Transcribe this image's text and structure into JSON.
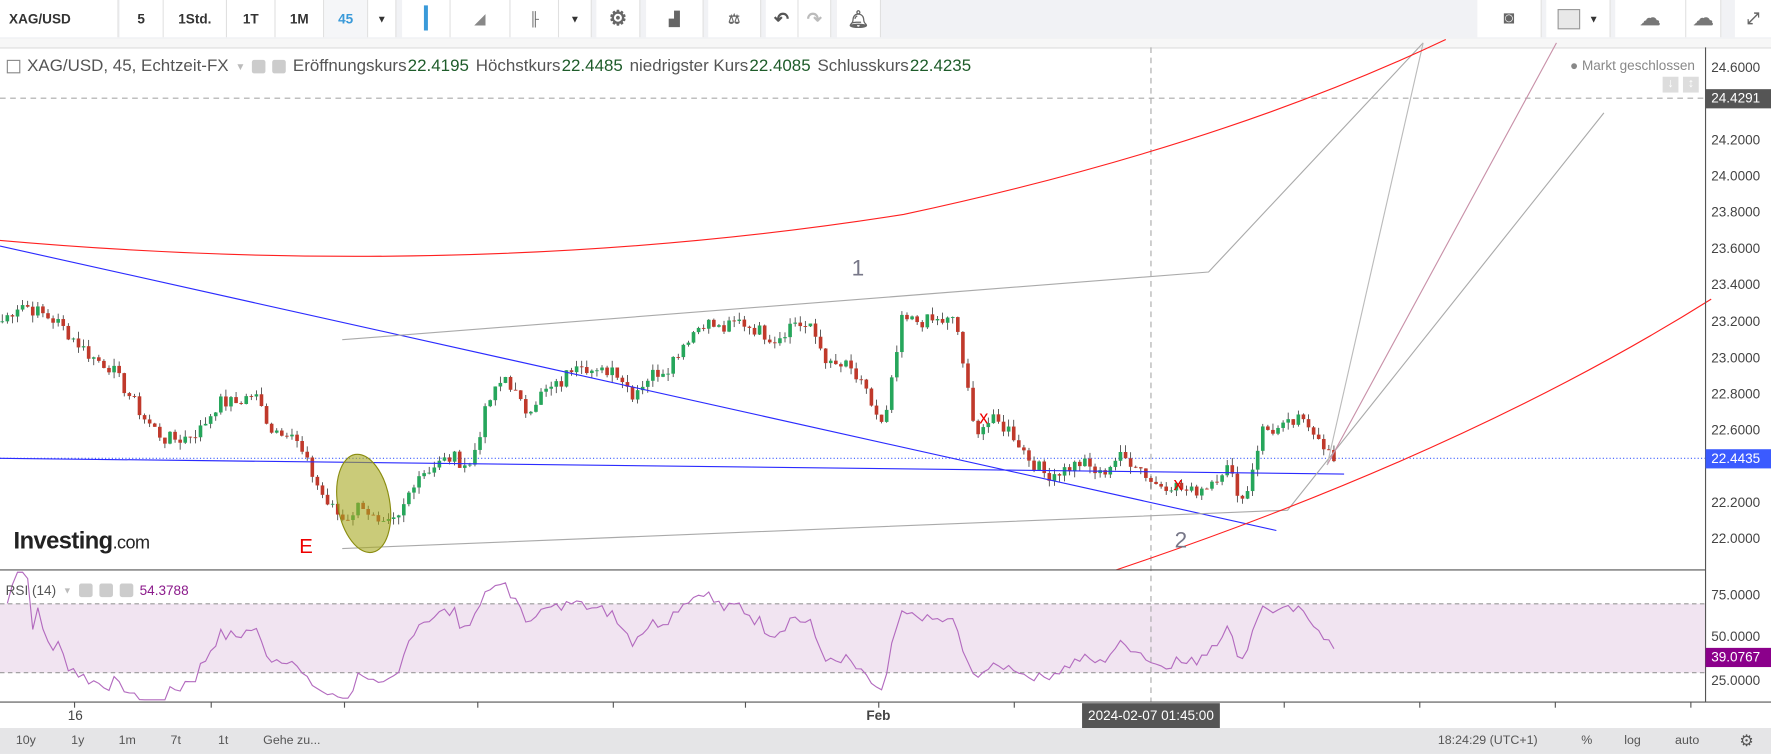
{
  "toolbar": {
    "symbol": "XAG/USD",
    "intervals": [
      "5",
      "1Std.",
      "1T",
      "1M",
      "45"
    ],
    "active_interval": "45",
    "icons": [
      "candlestick-icon",
      "area-chart-icon",
      "bar-chart-icon",
      "gear-icon",
      "indicators-icon",
      "compare-icon",
      "undo-icon",
      "redo-icon",
      "alert-icon",
      "camera-icon",
      "color-square-icon",
      "cloud-download-icon",
      "cloud-upload-icon",
      "fullscreen-icon"
    ]
  },
  "legend": {
    "title": "XAG/USD, 45, Echtzeit-FX",
    "open_label": "Eröffnungskurs",
    "open": "22.4195",
    "high_label": "Höchstkurs",
    "high": "22.4485",
    "low_label": "niedrigster Kurs",
    "low": "22.4085",
    "close_label": "Schlusskurs",
    "close": "22.4235"
  },
  "market_status": "Markt geschlossen",
  "price_axis": {
    "ticks": [
      "24.6000",
      "24.2000",
      "24.0000",
      "23.8000",
      "23.6000",
      "23.4000",
      "23.2000",
      "23.0000",
      "22.8000",
      "22.6000",
      "22.2000",
      "22.0000"
    ],
    "crosshair_price": "24.4291",
    "last_price": "22.4435"
  },
  "annotations": {
    "wave1": "1",
    "wave2": "2",
    "waveE": "E",
    "x_mark": "x"
  },
  "rsi": {
    "label": "RSI (14)",
    "value": "54.3788",
    "last": "39.0767",
    "ticks": [
      "75.0000",
      "50.0000",
      "25.0000"
    ],
    "upper_band": 70,
    "lower_band": 30
  },
  "time_axis": {
    "labels": [
      "16",
      "Feb"
    ],
    "crosshair_time": "2024-02-07 01:45:00"
  },
  "bottom": {
    "ranges": [
      "10y",
      "1y",
      "1m",
      "7t",
      "1t"
    ],
    "goto": "Gehe zu...",
    "clock": "18:24:29 (UTC+1)",
    "percent": "%",
    "log": "log",
    "auto": "auto"
  },
  "logo": {
    "text": "Investing",
    "suffix": ".com"
  },
  "colors": {
    "up": "#26a65b",
    "down": "#c0392b",
    "accent": "#3a9ad9",
    "rsi": "#b36bbf",
    "rsi_fill": "#f3e5f3",
    "trend_blue": "#2b2bff",
    "curve_red": "#ff2020"
  },
  "chart_data": {
    "type": "candlestick",
    "symbol": "XAG/USD",
    "interval": "45",
    "closes": [
      23.2,
      23.3,
      23.25,
      23.2,
      23.1,
      23.0,
      22.95,
      22.8,
      22.65,
      22.55,
      22.55,
      22.6,
      22.75,
      22.75,
      22.8,
      22.6,
      22.6,
      22.4,
      22.2,
      22.1,
      22.2,
      22.05,
      22.1,
      22.35,
      22.4,
      22.45,
      22.4,
      22.75,
      22.9,
      22.7,
      22.8,
      22.85,
      23.0,
      22.9,
      22.95,
      22.8,
      22.9,
      22.95,
      23.1,
      23.2,
      23.15,
      23.2,
      23.15,
      23.1,
      23.2,
      23.15,
      22.95,
      22.95,
      22.8,
      22.6,
      23.2,
      23.2,
      23.2,
      23.2,
      22.6,
      22.65,
      22.6,
      22.45,
      22.35,
      22.38,
      22.42,
      22.35,
      22.45,
      22.42,
      22.3,
      22.3,
      22.25,
      22.3,
      22.4,
      22.2,
      22.6,
      22.6,
      22.65,
      22.6,
      22.42
    ],
    "ylim": [
      21.9,
      24.7
    ]
  }
}
